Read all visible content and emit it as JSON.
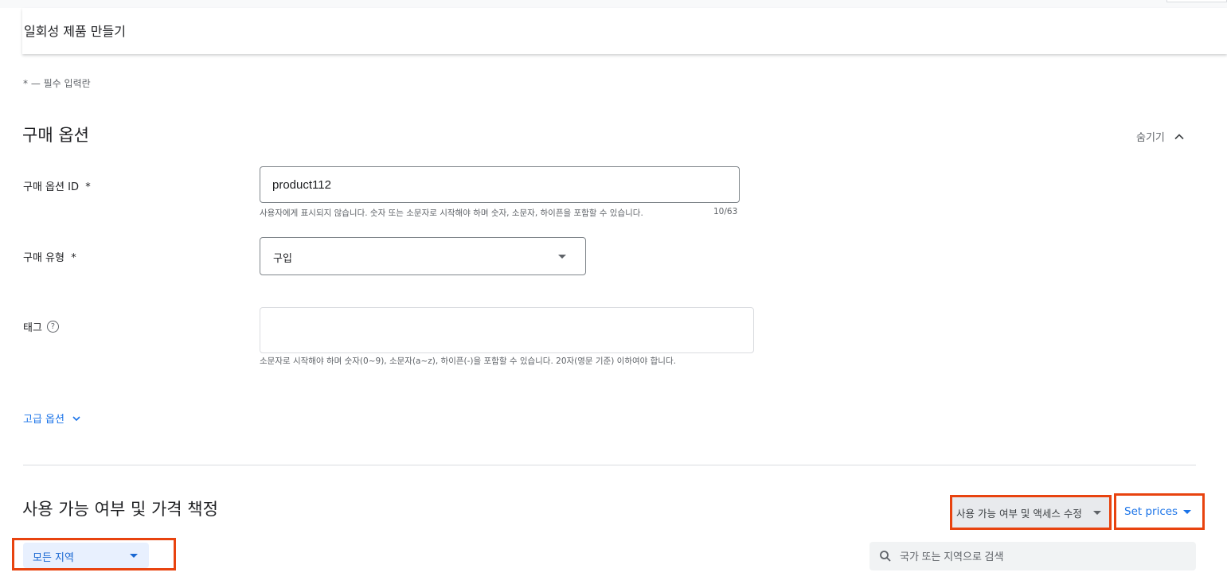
{
  "header": {
    "title": "일회성 제품 만들기"
  },
  "required_note": "* — 필수 입력란",
  "purchase_options": {
    "title": "구매 옵션",
    "hide_label": "숨기기",
    "id_field": {
      "label": "구매 옵션 ID  *",
      "value": "product112",
      "hint": "사용자에게 표시되지 않습니다. 숫자 또는 소문자로 시작해야 하며 숫자, 소문자, 하이픈을 포함할 수 있습니다.",
      "counter": "10/63"
    },
    "type_field": {
      "label": "구매 유형  *",
      "value": "구입"
    },
    "tag_field": {
      "label": "태그",
      "value": "",
      "hint": "소문자로 시작해야 하며 숫자(0~9), 소문자(a~z), 하이픈(-)을 포함할 수 있습니다. 20자(영문 기준) 이하여야 합니다."
    },
    "advanced_label": "고급 옵션"
  },
  "availability": {
    "title": "사용 가능 여부 및 가격 책정",
    "access_button": "사용 가능 여부 및 액세스 수정",
    "prices_button": "Set prices",
    "region_select": "모든 지역",
    "search_placeholder": "국가 또는 지역으로 검색"
  },
  "colors": {
    "accent": "#1a73e8",
    "highlight_box": "#e8430f"
  },
  "icons": [
    "chevron-up-icon",
    "chevron-down-icon",
    "help-icon",
    "dropdown-arrow-icon",
    "search-icon"
  ]
}
